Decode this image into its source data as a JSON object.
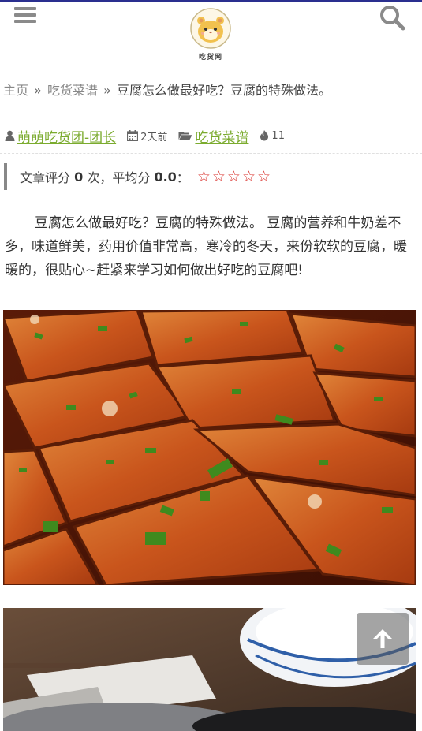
{
  "header": {
    "logo_text": "吃货网",
    "icons": {
      "menu": "menu-icon",
      "search": "search-icon",
      "logo": "hamster-logo"
    }
  },
  "breadcrumb": {
    "home": "主页",
    "separator": "»",
    "category": "吃货菜谱",
    "current": "豆腐怎么做最好吃？豆腐的特殊做法。"
  },
  "meta": {
    "author": "萌萌吃货团-团长",
    "time": "2天前",
    "category": "吃货菜谱",
    "views": "11",
    "icons": [
      "user-icon",
      "calendar-icon",
      "folder-icon",
      "flame-icon"
    ]
  },
  "rating": {
    "label_prefix": "文章评分",
    "count": "0",
    "label_mid": "次，平均分",
    "average": "0.0",
    "label_suffix": "：",
    "stars_total": 5,
    "star_color": "#d9302b"
  },
  "article": {
    "intro": "豆腐怎么做最好吃？豆腐的特殊做法。 豆腐的营养和牛奶差不多，味道鲜美，药用价值非常高，寒冷的冬天，来份软软的豆腐，暖暖的，很贴心~赶紧来学习如何做出好吃的豆腐吧!"
  },
  "colors": {
    "accent_green": "#7bab2e",
    "top_bar": "#2a2f8f",
    "star_red": "#d9302b"
  }
}
